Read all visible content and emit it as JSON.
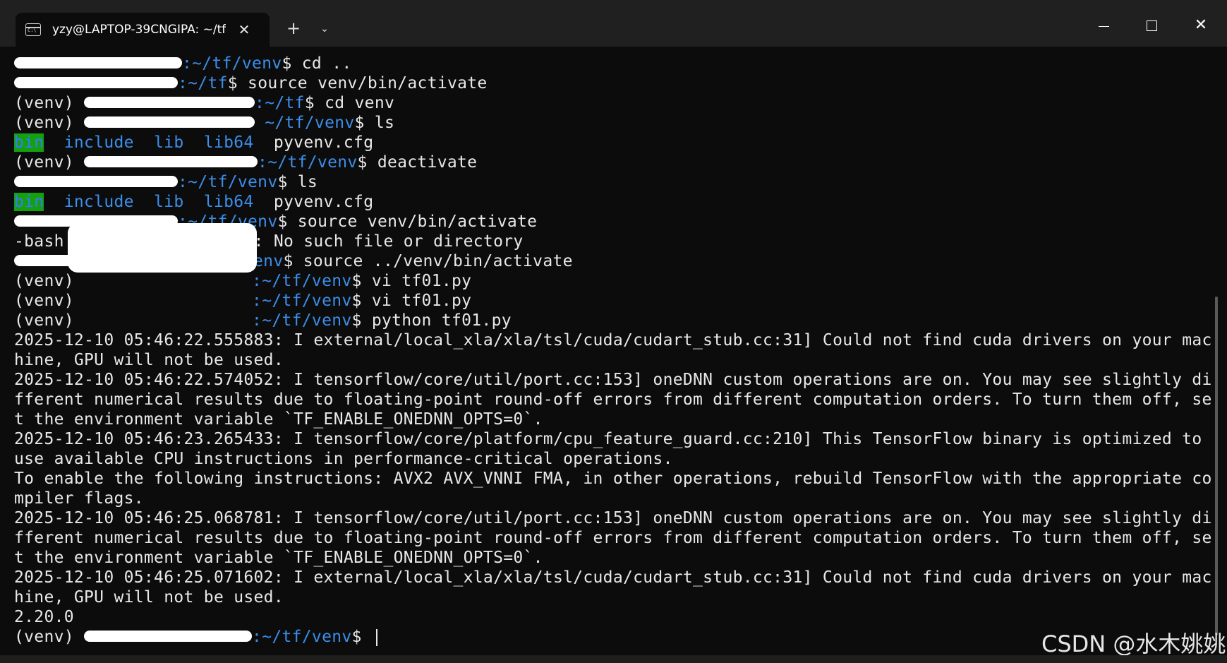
{
  "window": {
    "tab_title": "yzy@LAPTOP-39CNGIPA: ~/tf,",
    "tab_close": "✕",
    "new_tab": "+",
    "dropdown": "⌄",
    "close": "✕"
  },
  "terminal": {
    "lines": [
      {
        "venv": "",
        "redacted": true,
        "colon": ":",
        "path": "~/tf/venv",
        "prompt": "$ ",
        "cmd": "cd .."
      },
      {
        "venv": "",
        "redacted": true,
        "colon": ":",
        "path": "~/tf",
        "prompt": "$ ",
        "cmd": "source venv/bin/activate"
      },
      {
        "venv": "(venv) ",
        "redacted": true,
        "colon": ":",
        "path": "~/tf",
        "prompt": "$ ",
        "cmd": "cd venv"
      },
      {
        "venv": "(venv) ",
        "redacted": true,
        "colon": " ",
        "path": "~/tf/venv",
        "prompt": "$ ",
        "cmd": "ls"
      },
      {
        "ls": [
          "bin",
          "include",
          "lib",
          "lib64",
          "pyvenv.cfg"
        ]
      },
      {
        "venv": "(venv) ",
        "redacted": true,
        "colon": ":",
        "path": "~/tf/venv",
        "prompt": "$ ",
        "cmd": "deactivate"
      },
      {
        "venv": "",
        "redacted": true,
        "colon": ":",
        "path": "~/tf/venv",
        "prompt": "$ ",
        "cmd": "ls"
      },
      {
        "ls": [
          "bin",
          "include",
          "lib",
          "lib64",
          "pyvenv.cfg"
        ]
      },
      {
        "venv": "",
        "redacted": true,
        "colon": ":",
        "path": "~/tf/venv",
        "prompt": "$ ",
        "cmd": "source venv/bin/activate"
      },
      {
        "text": "-bash: venv/bin/activate: No such file or directory"
      },
      {
        "venv": "",
        "redacted": true,
        "colon": " ",
        "path": "~/tf/venv",
        "prompt": "$ ",
        "cmd": "source ../venv/bin/activate"
      },
      {
        "venv": "(venv) ",
        "redacted": false,
        "colon": ":",
        "path": "~/tf/venv",
        "prompt": "$ ",
        "cmd": "vi tf01.py"
      },
      {
        "venv": "(venv) ",
        "redacted": false,
        "colon": ":",
        "path": "~/tf/venv",
        "prompt": "$ ",
        "cmd": "vi tf01.py"
      },
      {
        "venv": "(venv) ",
        "redacted": false,
        "colon": ":",
        "path": "~/tf/venv",
        "prompt": "$ ",
        "cmd": "python tf01.py"
      },
      {
        "text": "2025-12-10 05:46:22.555883: I external/local_xla/xla/tsl/cuda/cudart_stub.cc:31] Could not find cuda drivers on your mac"
      },
      {
        "text": "hine, GPU will not be used."
      },
      {
        "text": "2025-12-10 05:46:22.574052: I tensorflow/core/util/port.cc:153] oneDNN custom operations are on. You may see slightly di"
      },
      {
        "text": "fferent numerical results due to floating-point round-off errors from different computation orders. To turn them off, se"
      },
      {
        "text": "t the environment variable `TF_ENABLE_ONEDNN_OPTS=0`."
      },
      {
        "text": "2025-12-10 05:46:23.265433: I tensorflow/core/platform/cpu_feature_guard.cc:210] This TensorFlow binary is optimized to"
      },
      {
        "text": "use available CPU instructions in performance-critical operations."
      },
      {
        "text": "To enable the following instructions: AVX2 AVX_VNNI FMA, in other operations, rebuild TensorFlow with the appropriate co"
      },
      {
        "text": "mpiler flags."
      },
      {
        "text": "2025-12-10 05:46:25.068781: I tensorflow/core/util/port.cc:153] oneDNN custom operations are on. You may see slightly di"
      },
      {
        "text": "fferent numerical results due to floating-point round-off errors from different computation orders. To turn them off, se"
      },
      {
        "text": "t the environment variable `TF_ENABLE_ONEDNN_OPTS=0`."
      },
      {
        "text": "2025-12-10 05:46:25.071602: I external/local_xla/xla/tsl/cuda/cudart_stub.cc:31] Could not find cuda drivers on your mac"
      },
      {
        "text": "hine, GPU will not be used."
      },
      {
        "text": "2.20.0"
      },
      {
        "venv": "(venv) ",
        "redacted": true,
        "colon": ":",
        "path": "~/tf/venv",
        "prompt": "$ ",
        "cmd": "",
        "cursor": true
      }
    ]
  },
  "watermark": "CSDN @水木姚姚",
  "colors": {
    "background": "#0c0c0c",
    "titlebar": "#202020",
    "path_blue": "#3b8eea",
    "bin_bg": "#13a10e",
    "text": "#cccccc"
  }
}
